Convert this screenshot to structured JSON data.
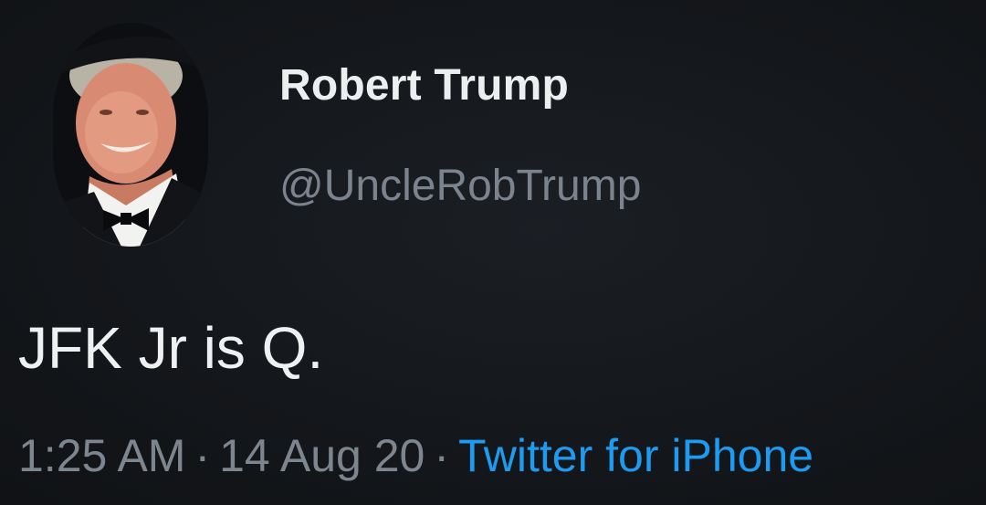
{
  "tweet": {
    "display_name": "Robert Trump",
    "handle": "@UncleRobTrump",
    "text": "JFK Jr is Q.",
    "time": "1:25 AM",
    "date": "14 Aug 20",
    "separator": "·",
    "source": "Twitter for iPhone"
  },
  "colors": {
    "background": "#15181c",
    "name": "#eceef0",
    "muted": "#7b848e",
    "link": "#1d9bf0"
  }
}
